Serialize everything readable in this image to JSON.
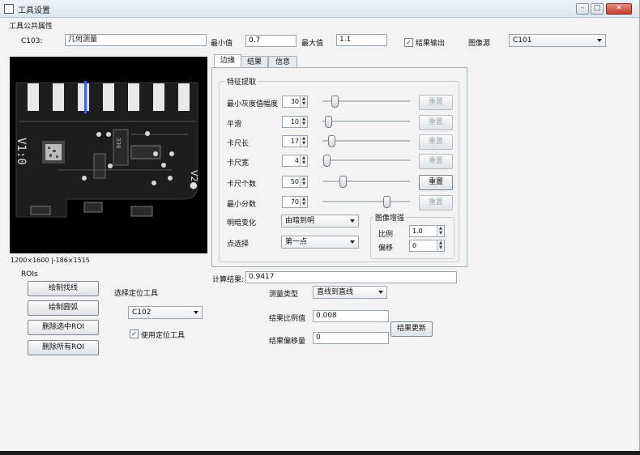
{
  "window": {
    "title": "工具设置",
    "controls": {
      "minimize": "–",
      "maximize": "□",
      "close": "✕"
    }
  },
  "public_props": {
    "heading": "工具公共属性",
    "id_label": "C103:",
    "name_value": "几何测量",
    "min_label": "最小值",
    "min_value": "0.7",
    "max_label": "最大值",
    "max_value": "1.1",
    "result_output_label": "结果输出",
    "result_output_checked": true,
    "image_source_label": "图像源",
    "image_source_value": "C101"
  },
  "image_panel": {
    "status": "1200×1600 |-186×1515",
    "board_text": {
      "version": "V1:0",
      "right_mark": "V2●",
      "code": "336"
    }
  },
  "tabs": [
    {
      "label": "边缘",
      "active": true
    },
    {
      "label": "结果",
      "active": false
    },
    {
      "label": "信息",
      "active": false
    }
  ],
  "feature": {
    "heading": "特征提取",
    "rows": [
      {
        "label": "最小灰度值幅度",
        "value": "30",
        "slider_fraction": 0.13,
        "reset": "重置",
        "reset_enabled": false
      },
      {
        "label": "平滑",
        "value": "10",
        "slider_fraction": 0.06,
        "reset": "重置",
        "reset_enabled": false
      },
      {
        "label": "卡尺长",
        "value": "17",
        "slider_fraction": 0.09,
        "reset": "重置",
        "reset_enabled": false
      },
      {
        "label": "卡尺宽",
        "value": "4",
        "slider_fraction": 0.04,
        "reset": "重置",
        "reset_enabled": false
      },
      {
        "label": "卡尺个数",
        "value": "50",
        "slider_fraction": 0.22,
        "reset": "重置",
        "reset_enabled": true
      },
      {
        "label": "最小分数",
        "value": "70",
        "slider_fraction": 0.72,
        "reset": "重置",
        "reset_enabled": false
      }
    ],
    "polarity_label": "明暗变化",
    "polarity_value": "由暗到明",
    "point_label": "点选择",
    "point_value": "第一点",
    "enhance": {
      "heading": "图像增强",
      "scale_label": "比例",
      "scale_value": "1.0",
      "offset_label": "偏移",
      "offset_value": "0"
    }
  },
  "calc": {
    "label": "计算结果:",
    "value": "0.9417"
  },
  "roi": {
    "heading": "ROIs",
    "buttons": [
      "绘制找线",
      "绘制圆弧",
      "删除选中ROI",
      "删除所有ROI"
    ]
  },
  "locate": {
    "heading": "选择定位工具",
    "tool_value": "C102",
    "use_label": "使用定位工具",
    "use_checked": true
  },
  "measure": {
    "type_label": "测量类型",
    "type_value": "直线到直线",
    "scale_label": "结果比例值",
    "scale_value": "0.008",
    "offset_label": "结果偏移量",
    "offset_value": "0",
    "update_button": "结果更新"
  }
}
